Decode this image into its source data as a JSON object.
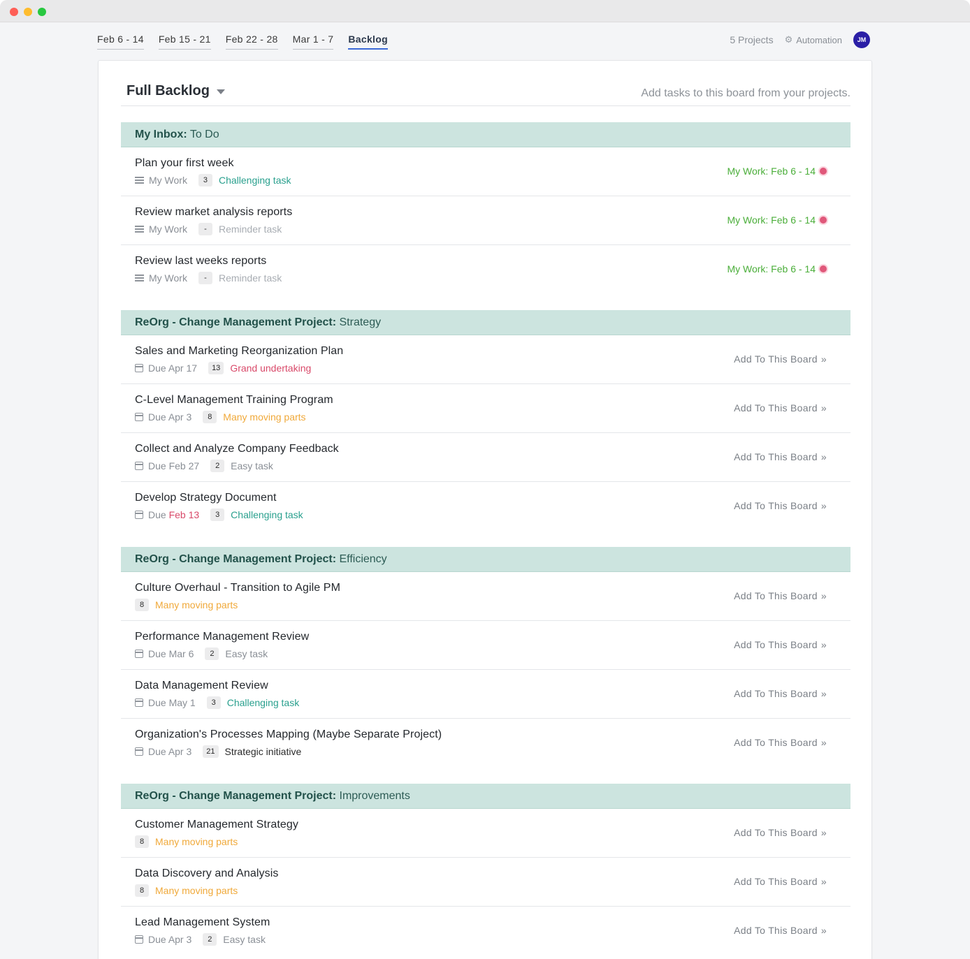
{
  "window": {
    "controls": [
      "close",
      "minimize",
      "zoom"
    ]
  },
  "nav": {
    "tabs": [
      {
        "label": "Feb 6 - 14",
        "active": false
      },
      {
        "label": "Feb 15 - 21",
        "active": false
      },
      {
        "label": "Feb 22 - 28",
        "active": false
      },
      {
        "label": "Mar 1 - 7",
        "active": false
      },
      {
        "label": "Backlog",
        "active": true
      }
    ],
    "projects_count": "5 Projects",
    "automation_label": "Automation",
    "avatar_initials": "JM"
  },
  "board": {
    "title": "Full Backlog",
    "hint": "Add tasks to this board from your projects."
  },
  "add_label": "Add To This Board",
  "groups": [
    {
      "project": "My Inbox:",
      "column": "To Do",
      "tasks": [
        {
          "title": "Plan your first week",
          "owner": "My Work",
          "points": "3",
          "size": "Challenging task",
          "board": "My Work: Feb 6 - 14"
        },
        {
          "title": "Review market analysis reports",
          "owner": "My Work",
          "points": "-",
          "size": "Reminder task",
          "board": "My Work: Feb 6 - 14"
        },
        {
          "title": "Review last weeks reports",
          "owner": "My Work",
          "points": "-",
          "size": "Reminder task",
          "board": "My Work: Feb 6 - 14"
        }
      ]
    },
    {
      "project": "ReOrg - Change Management Project:",
      "column": "Strategy",
      "tasks": [
        {
          "title": "Sales and Marketing Reorganization Plan",
          "due_prefix": "Due",
          "due": "Apr 17",
          "points": "13",
          "size": "Grand undertaking"
        },
        {
          "title": "C-Level Management Training Program",
          "due_prefix": "Due",
          "due": "Apr 3",
          "points": "8",
          "size": "Many moving parts"
        },
        {
          "title": "Collect and Analyze Company Feedback",
          "due_prefix": "Due",
          "due": "Feb 27",
          "points": "2",
          "size": "Easy task"
        },
        {
          "title": "Develop Strategy Document",
          "due_prefix": "Due",
          "due": "Feb 13",
          "points": "3",
          "size": "Challenging task"
        }
      ]
    },
    {
      "project": "ReOrg - Change Management Project:",
      "column": "Efficiency",
      "tasks": [
        {
          "title": "Culture Overhaul - Transition to Agile PM",
          "points": "8",
          "size": "Many moving parts"
        },
        {
          "title": "Performance Management Review",
          "due_prefix": "Due",
          "due": "Mar 6",
          "points": "2",
          "size": "Easy task"
        },
        {
          "title": "Data Management Review",
          "due_prefix": "Due",
          "due": "May 1",
          "points": "3",
          "size": "Challenging task"
        },
        {
          "title": "Organization's Processes Mapping (Maybe Separate Project)",
          "due_prefix": "Due",
          "due": "Apr 3",
          "points": "21",
          "size": "Strategic initiative"
        }
      ]
    },
    {
      "project": "ReOrg - Change Management Project:",
      "column": "Improvements",
      "tasks": [
        {
          "title": "Customer Management Strategy",
          "points": "8",
          "size": "Many moving parts"
        },
        {
          "title": "Data Discovery and Analysis",
          "points": "8",
          "size": "Many moving parts"
        },
        {
          "title": "Lead Management System",
          "due_prefix": "Due",
          "due": "Apr 3",
          "points": "2",
          "size": "Easy task"
        }
      ]
    }
  ],
  "colors": {
    "group_header_bg": "#cce4df",
    "active_tab_underline": "#3b6ad8",
    "board_link": "#4bae3a",
    "overdue": "#d94a6a",
    "challenging": "#2aa08e",
    "many_moving_parts": "#f0a93a",
    "avatar_bg": "#2b1fa6"
  },
  "icons": [
    "list-icon",
    "calendar-icon",
    "gear-icon",
    "chevron-double-right-icon",
    "caret-down-icon",
    "status-dot-icon"
  ]
}
